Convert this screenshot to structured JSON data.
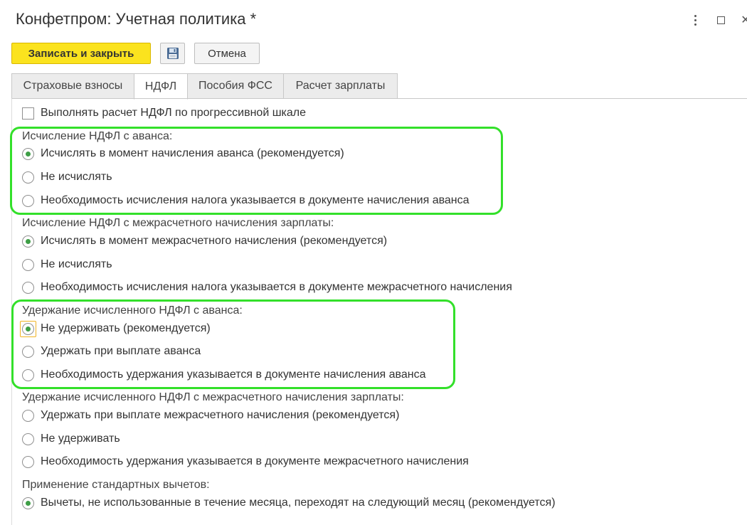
{
  "window": {
    "title": "Конфетпром: Учетная политика *"
  },
  "toolbar": {
    "save_close_label": "Записать и закрыть",
    "cancel_label": "Отмена"
  },
  "tabs": [
    {
      "label": "Страховые взносы"
    },
    {
      "label": "НДФЛ"
    },
    {
      "label": "Пособия ФСС"
    },
    {
      "label": "Расчет зарплаты"
    }
  ],
  "progressive_scale": {
    "label": "Выполнять расчет НДФЛ по прогрессивной шкале"
  },
  "groups": [
    {
      "label": "Исчисление НДФЛ с аванса:",
      "options": [
        {
          "label": "Исчислять в момент начисления аванса (рекомендуется)"
        },
        {
          "label": "Не исчислять"
        },
        {
          "label": "Необходимость исчисления налога указывается в документе начисления аванса"
        }
      ]
    },
    {
      "label": "Исчисление НДФЛ с межрасчетного начисления зарплаты:",
      "options": [
        {
          "label": "Исчислять в момент межрасчетного начисления (рекомендуется)"
        },
        {
          "label": "Не исчислять"
        },
        {
          "label": "Необходимость исчисления налога указывается в документе межрасчетного начисления"
        }
      ]
    },
    {
      "label": "Удержание исчисленного НДФЛ с аванса:",
      "options": [
        {
          "label": "Не удерживать (рекомендуется)"
        },
        {
          "label": "Удержать при выплате аванса"
        },
        {
          "label": "Необходимость удержания указывается в документе начисления аванса"
        }
      ]
    },
    {
      "label": "Удержание исчисленного НДФЛ с межрасчетного начисления зарплаты:",
      "options": [
        {
          "label": "Удержать при выплате межрасчетного начисления (рекомендуется)"
        },
        {
          "label": "Не удерживать"
        },
        {
          "label": "Необходимость удержания указывается в документе межрасчетного начисления"
        }
      ]
    },
    {
      "label": "Применение стандартных вычетов:",
      "options": [
        {
          "label": "Вычеты, не использованные в течение месяца, переходят на следующий месяц (рекомендуется)"
        }
      ]
    }
  ],
  "colors": {
    "accent_yellow": "#fbe31e",
    "radio_dot": "#3e9e46",
    "highlight_green": "#33e02a",
    "focus_orange": "#f0b323"
  }
}
